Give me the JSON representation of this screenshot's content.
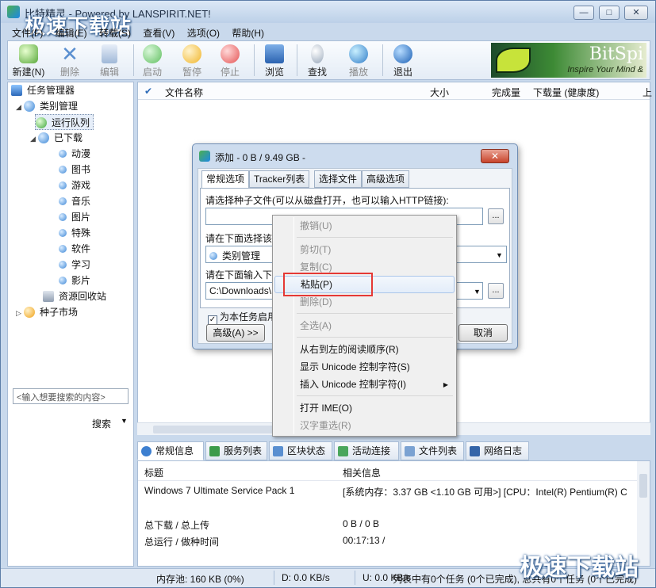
{
  "window": {
    "title": "比特精灵 - Powered by LANSPIRIT.NET!",
    "watermark": "极速下载站"
  },
  "menu": [
    "文件(F)",
    "编辑(E)",
    "转载(S)",
    "查看(V)",
    "选项(O)",
    "帮助(H)"
  ],
  "toolbar": {
    "new": "新建(N)",
    "delete": "删除",
    "edit": "编辑",
    "start": "启动",
    "pause": "暂停",
    "stop": "停止",
    "browse": "浏览",
    "find": "查找",
    "play": "播放",
    "exit": "退出",
    "banner_title": "BitSpi",
    "banner_sub": "Inspire Your Mind &"
  },
  "tree": {
    "root": "任务管理器",
    "category": "类别管理",
    "running": "运行队列",
    "downloaded": "已下载",
    "items": [
      "动漫",
      "图书",
      "游戏",
      "音乐",
      "图片",
      "特殊",
      "软件",
      "学习",
      "影片"
    ],
    "recycle": "资源回收站",
    "market": "种子市场"
  },
  "search": {
    "placeholder": "<输入想要搜索的内容>",
    "button": "搜索"
  },
  "list_columns": {
    "name": "文件名称",
    "size": "大小",
    "done": "完成量",
    "download": "下载量 (健康度)",
    "up": "上"
  },
  "bottom_tabs": [
    "常规信息",
    "服务列表",
    "区块状态",
    "活动连接",
    "文件列表",
    "网络日志"
  ],
  "info": {
    "head_title": "标题",
    "head_info": "相关信息",
    "os": "Windows 7 Ultimate Service Pack 1",
    "sys": "[系统内存：3.37 GB <1.10 GB 可用>] [CPU：Intel(R) Pentium(R) C",
    "total_dl_label": "总下载 / 总上传",
    "total_dl_value": "0 B / 0 B",
    "run_label": "总运行 / 做种时间",
    "run_value": "00:17:13 /"
  },
  "status": {
    "mem": "内存池: 160 KB (0%)",
    "down": "D: 0.0 KB/s",
    "up": "U: 0.0 KB/s",
    "queue": "列表中有0个任务 (0个已完成), 总共有0个任务 (0个已完成)"
  },
  "dialog": {
    "title": "添加 - 0 B / 9.49 GB -",
    "close": "✕",
    "tabs": [
      "常规选项",
      "Tracker列表",
      "选择文件",
      "高级选项"
    ],
    "torrent_label": "请选择种子文件(可以从磁盘打开，也可以输入HTTP链接):",
    "torrent_value": "",
    "category_label": "请在下面选择该",
    "category_value": "类别管理",
    "path_label": "请在下面输入下",
    "path_value": "C:\\Downloads\\",
    "start_check": "为本任务启用",
    "advanced": "高级(A) >>",
    "cancel": "取消",
    "browse_btn": "..."
  },
  "context_menu": {
    "undo": "撤销(U)",
    "cut": "剪切(T)",
    "copy": "复制(C)",
    "paste": "粘贴(P)",
    "delete": "删除(D)",
    "select_all": "全选(A)",
    "rtl": "从右到左的阅读顺序(R)",
    "show_unicode": "显示 Unicode 控制字符(S)",
    "insert_unicode": "插入 Unicode 控制字符(I)",
    "ime_open": "打开 IME(O)",
    "reconvert": "汉字重选(R)"
  },
  "colors": {
    "highlight_box": "#e53935",
    "accent": "#3b86d6"
  }
}
